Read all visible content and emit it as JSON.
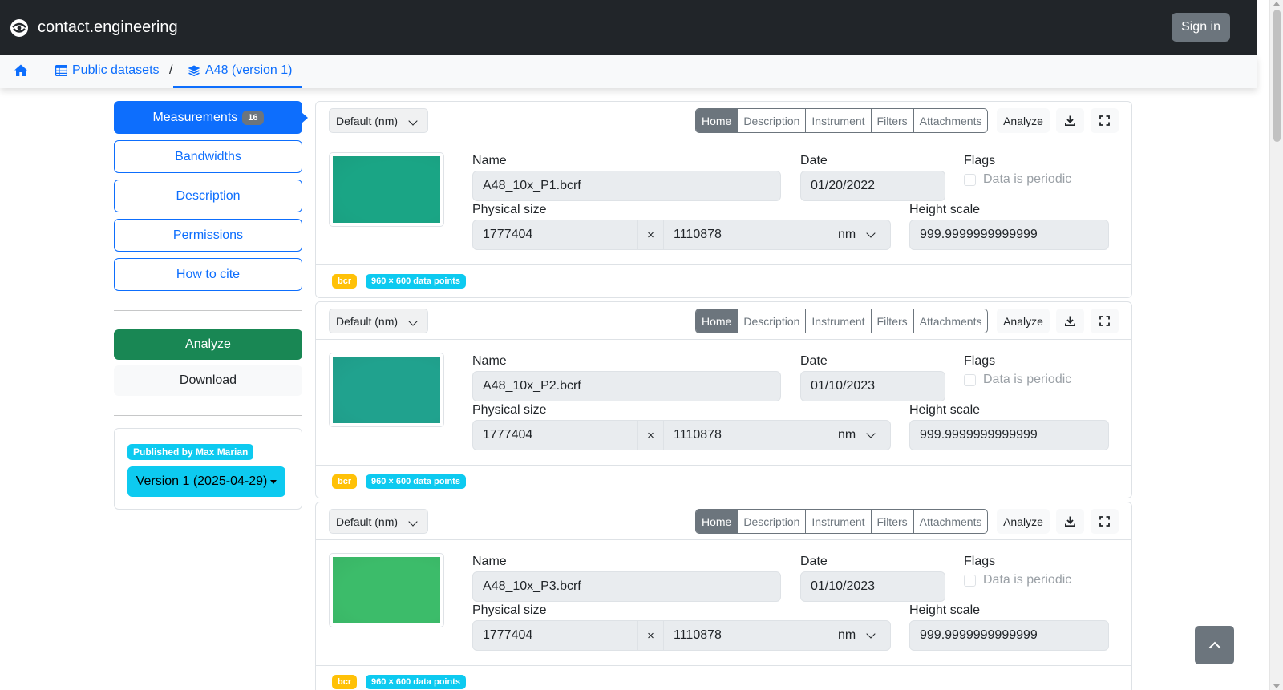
{
  "navbar": {
    "brand": "contact.engineering",
    "signin_label": "Sign in"
  },
  "breadcrumb": {
    "public_datasets": "Public datasets",
    "separator": "/",
    "dataset": "A48 (version 1)"
  },
  "sidebar": {
    "measurements_label": "Measurements",
    "measurements_count": "16",
    "items": [
      "Bandwidths",
      "Description",
      "Permissions",
      "How to cite"
    ],
    "analyze_label": "Analyze",
    "download_label": "Download",
    "published_by": "Published by Max Marian",
    "version_label": "Version 1 (2025-04-29)"
  },
  "card_labels": {
    "unit_select": "Default (nm)",
    "tabs": [
      "Home",
      "Description",
      "Instrument",
      "Filters",
      "Attachments"
    ],
    "analyze": "Analyze",
    "name": "Name",
    "date": "Date",
    "flags": "Flags",
    "periodic": "Data is periodic",
    "physical_size": "Physical size",
    "times": "×",
    "height_scale": "Height scale"
  },
  "measurements": [
    {
      "name": "A48_10x_P1.bcrf",
      "date": "01/20/2022",
      "size_x": "1777404",
      "size_y": "1110878",
      "unit": "nm",
      "height_scale": "999.9999999999999",
      "format": "bcr",
      "points": "960 × 600 data points",
      "thumb_color": "#1aa585"
    },
    {
      "name": "A48_10x_P2.bcrf",
      "date": "01/10/2023",
      "size_x": "1777404",
      "size_y": "1110878",
      "unit": "nm",
      "height_scale": "999.9999999999999",
      "format": "bcr",
      "points": "960 × 600 data points",
      "thumb_color": "#20a28e"
    },
    {
      "name": "A48_10x_P3.bcrf",
      "date": "01/10/2023",
      "size_x": "1777404",
      "size_y": "1110878",
      "unit": "nm",
      "height_scale": "999.9999999999999",
      "format": "bcr",
      "points": "960 × 600 data points",
      "thumb_color": "#3cbc6a"
    }
  ],
  "colors": {
    "primary": "#0d6efd",
    "success": "#198754",
    "info": "#0dcaf0",
    "warning": "#ffc107",
    "secondary": "#6c757d",
    "dark": "#212529"
  }
}
